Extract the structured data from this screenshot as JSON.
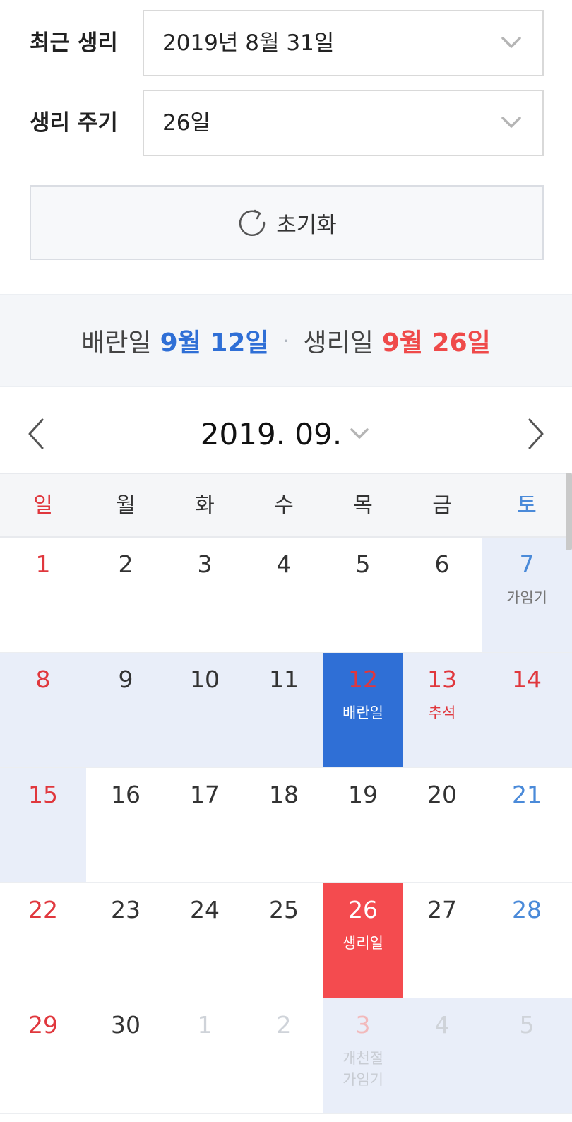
{
  "form": {
    "recent_period_label": "최근 생리",
    "recent_period_value": "2019년 8월 31일",
    "cycle_label": "생리 주기",
    "cycle_value": "26일",
    "reset_label": "초기화"
  },
  "summary": {
    "ovulation_label": "배란일",
    "ovulation_date": "9월 12일",
    "period_label": "생리일",
    "period_date": "9월 26일",
    "separator": "·"
  },
  "calendar": {
    "month_title": "2019. 09.",
    "weekdays": [
      "일",
      "월",
      "화",
      "수",
      "목",
      "금",
      "토"
    ],
    "weeks": [
      [
        {
          "day": "1",
          "label": "",
          "color": "red",
          "state": "normal"
        },
        {
          "day": "2",
          "label": "",
          "color": "default",
          "state": "normal"
        },
        {
          "day": "3",
          "label": "",
          "color": "default",
          "state": "normal"
        },
        {
          "day": "4",
          "label": "",
          "color": "default",
          "state": "normal"
        },
        {
          "day": "5",
          "label": "",
          "color": "default",
          "state": "normal"
        },
        {
          "day": "6",
          "label": "",
          "color": "default",
          "state": "normal"
        },
        {
          "day": "7",
          "label": "가임기",
          "color": "blue",
          "state": "fertile"
        }
      ],
      [
        {
          "day": "8",
          "label": "",
          "color": "red",
          "state": "fertile"
        },
        {
          "day": "9",
          "label": "",
          "color": "default",
          "state": "fertile"
        },
        {
          "day": "10",
          "label": "",
          "color": "default",
          "state": "fertile"
        },
        {
          "day": "11",
          "label": "",
          "color": "default",
          "state": "fertile"
        },
        {
          "day": "12",
          "label": "배란일",
          "color": "red",
          "state": "ovulation"
        },
        {
          "day": "13",
          "label": "추석",
          "color": "red",
          "state": "fertile"
        },
        {
          "day": "14",
          "label": "",
          "color": "red",
          "state": "fertile"
        }
      ],
      [
        {
          "day": "15",
          "label": "",
          "color": "red",
          "state": "fertile"
        },
        {
          "day": "16",
          "label": "",
          "color": "default",
          "state": "normal"
        },
        {
          "day": "17",
          "label": "",
          "color": "default",
          "state": "normal"
        },
        {
          "day": "18",
          "label": "",
          "color": "default",
          "state": "normal"
        },
        {
          "day": "19",
          "label": "",
          "color": "default",
          "state": "normal"
        },
        {
          "day": "20",
          "label": "",
          "color": "default",
          "state": "normal"
        },
        {
          "day": "21",
          "label": "",
          "color": "blue",
          "state": "normal"
        }
      ],
      [
        {
          "day": "22",
          "label": "",
          "color": "red",
          "state": "normal"
        },
        {
          "day": "23",
          "label": "",
          "color": "default",
          "state": "normal"
        },
        {
          "day": "24",
          "label": "",
          "color": "default",
          "state": "normal"
        },
        {
          "day": "25",
          "label": "",
          "color": "default",
          "state": "normal"
        },
        {
          "day": "26",
          "label": "생리일",
          "color": "white",
          "state": "period"
        },
        {
          "day": "27",
          "label": "",
          "color": "default",
          "state": "normal"
        },
        {
          "day": "28",
          "label": "",
          "color": "blue",
          "state": "normal"
        }
      ],
      [
        {
          "day": "29",
          "label": "",
          "color": "red",
          "state": "normal"
        },
        {
          "day": "30",
          "label": "",
          "color": "default",
          "state": "normal"
        },
        {
          "day": "1",
          "label": "",
          "color": "faded",
          "state": "normal"
        },
        {
          "day": "2",
          "label": "",
          "color": "faded",
          "state": "normal"
        },
        {
          "day": "3",
          "label": "개천절\n가임기",
          "color": "faded-red",
          "state": "fertile"
        },
        {
          "day": "4",
          "label": "",
          "color": "faded",
          "state": "fertile"
        },
        {
          "day": "5",
          "label": "",
          "color": "faded",
          "state": "fertile"
        }
      ]
    ]
  },
  "colors": {
    "red": "#e0373d",
    "blue": "#4a8ad9",
    "default": "#333333",
    "faded": "#cfd3d9",
    "faded-red": "#f2b9bb",
    "white": "#ffffff",
    "fertile_bg": "#e9eef9",
    "ovulation_bg": "#2f6fd6",
    "period_bg": "#f44b4f"
  }
}
